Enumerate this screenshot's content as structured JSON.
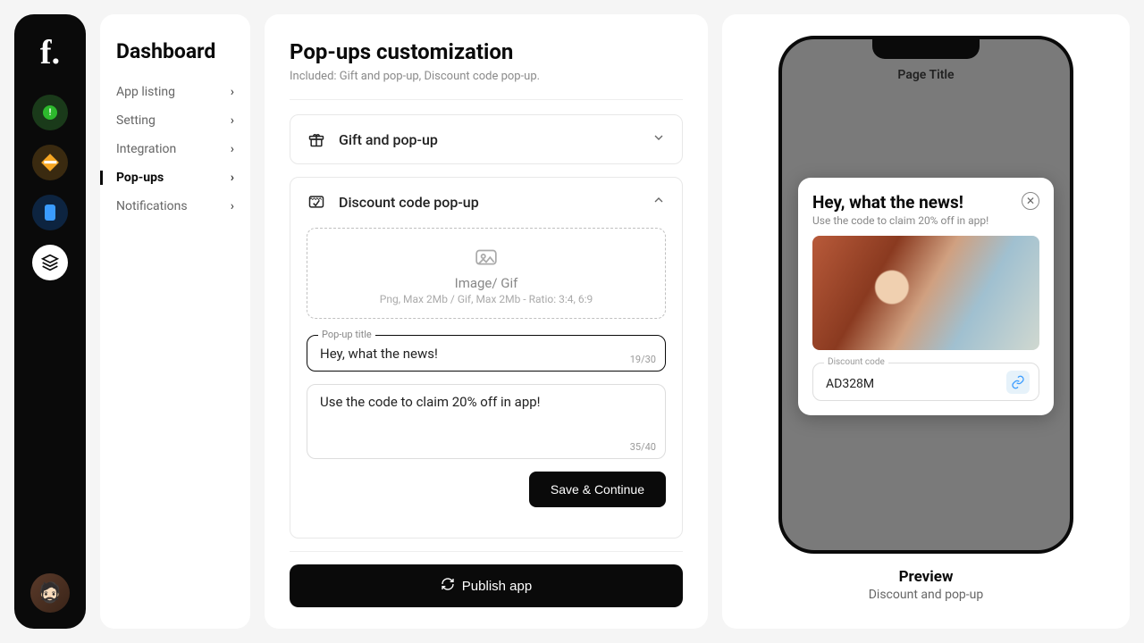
{
  "rail": {
    "logo": "f."
  },
  "sidebar": {
    "title": "Dashboard",
    "items": [
      {
        "label": "App listing",
        "active": false
      },
      {
        "label": "Setting",
        "active": false
      },
      {
        "label": "Integration",
        "active": false
      },
      {
        "label": "Pop-ups",
        "active": true
      },
      {
        "label": "Notifications",
        "active": false
      }
    ]
  },
  "main": {
    "title": "Pop-ups customization",
    "subtitle": "Included: Gift and pop-up, Discount code pop-up.",
    "accordion_gift": {
      "title": "Gift and pop-up"
    },
    "accordion_discount": {
      "title": "Discount code pop-up",
      "upload": {
        "title": "Image/ Gif",
        "hint": "Png, Max 2Mb / Gif, Max 2Mb - Ratio: 3:4, 6:9"
      },
      "title_field": {
        "label": "Pop-up title",
        "value": "Hey, what the news!",
        "counter": "19/30"
      },
      "desc_field": {
        "value": "Use the code to claim 20% off in app!",
        "counter": "35/40"
      },
      "save_label": "Save & Continue"
    },
    "publish_label": "Publish app"
  },
  "preview": {
    "phone_title": "Page Title",
    "popup": {
      "title": "Hey, what the news!",
      "subtitle": "Use the code to claim 20% off in app!",
      "discount_label": "Discount code",
      "discount_value": "AD328M"
    },
    "label": "Preview",
    "sub": "Discount and pop-up"
  }
}
